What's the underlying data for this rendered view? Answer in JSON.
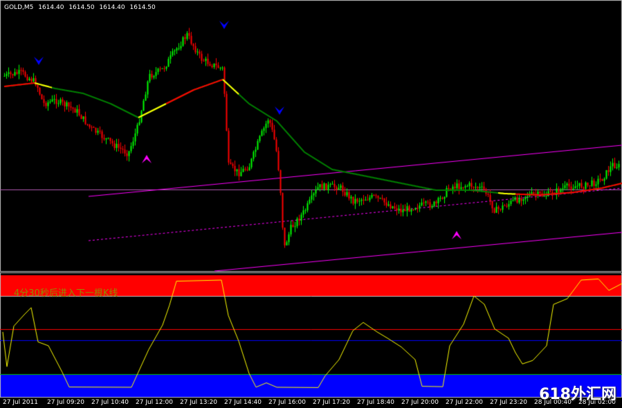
{
  "header": {
    "symbol": "GOLD,M5",
    "open": "1614.40",
    "high": "1614.50",
    "low": "1614.40",
    "close": "1614.50"
  },
  "indicator": {
    "countdown_text": "4分30秒后进入下一根K线"
  },
  "time_axis": {
    "labels": [
      "27 Jul 2011",
      "27 Jul 09:20",
      "27 Jul 10:40",
      "27 Jul 12:00",
      "27 Jul 13:20",
      "27 Jul 14:40",
      "27 Jul 16:00",
      "27 Jul 17:20",
      "27 Jul 18:40",
      "27 Jul 20:00",
      "27 Jul 22:00",
      "27 Jul 23:20",
      "28 Jul 00:40",
      "28 Jul 02:00"
    ]
  },
  "watermark": "618外汇网",
  "colors": {
    "background": "#000000",
    "bull_candle": "#00ff00",
    "bear_candle": "#ff0000",
    "ma_line": "#008000",
    "ma_up_segment": "#ff0000",
    "ma_flat_segment": "#ffff00",
    "channel": "#ff00ff",
    "arrow_buy": "#ff00ff",
    "arrow_sell": "#0000ff",
    "oscillator": "#ffff00",
    "zone_high": "#ff0000",
    "zone_low": "#0000ff"
  }
}
